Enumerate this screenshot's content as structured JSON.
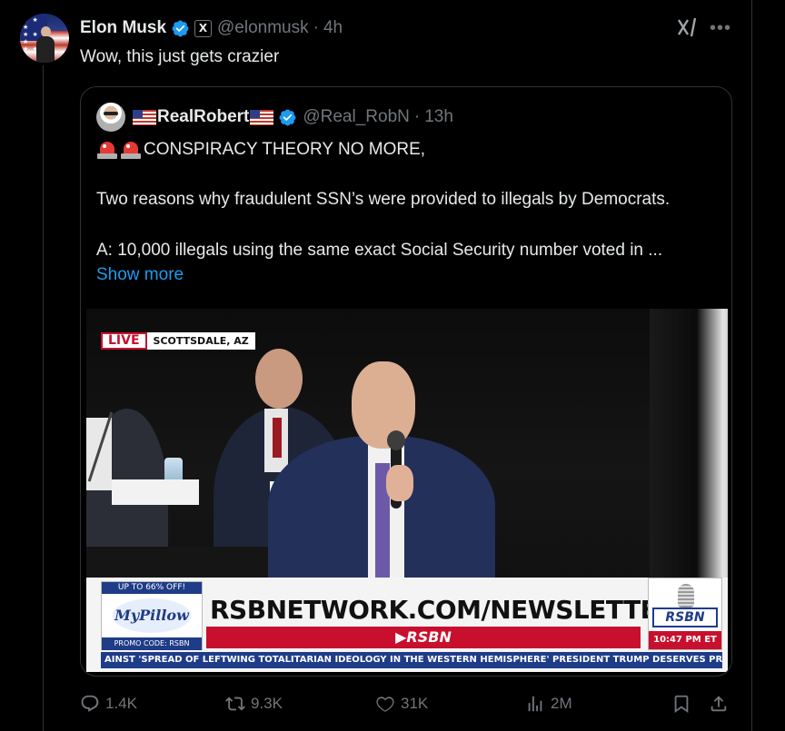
{
  "tweet": {
    "author_name": "Elon Musk",
    "x_badge": "X",
    "handle": "@elonmusk",
    "separator": "·",
    "time": "4h",
    "text": "Wow, this just gets crazier"
  },
  "quote": {
    "author_name": "RealRobert",
    "handle": "@Real_RobN",
    "separator": "·",
    "time": "13h",
    "line1": "CONSPIRACY THEORY NO MORE,",
    "line2": "Two reasons why fraudulent SSN’s were provided to illegals by Democrats.",
    "line3": "A: 10,000 illegals using the same exact Social Security number voted in ...",
    "show_more": "Show more"
  },
  "video": {
    "live": "LIVE",
    "location": "SCOTTSDALE, AZ",
    "pillow_top": "UP TO 66% OFF!",
    "pillow_logo": "MyPillow",
    "pillow_promo": "PROMO CODE: RSBN",
    "headline": "RSBNETWORK.COM/NEWSLETTER",
    "rsbn_bar": "▶RSBN",
    "rsbn_logo": "RSBN",
    "clock": "10:47 PM ET",
    "ticker": "AINST 'SPREAD OF LEFTWING TOTALITARIAN IDEOLOGY IN THE WESTERN HEMISPHERE'    PRESIDENT TRUMP DESERVES PRAISE"
  },
  "actions": {
    "replies": "1.4K",
    "reposts": "9.3K",
    "likes": "31K",
    "views": "2M"
  },
  "colors": {
    "background": "#000000",
    "text": "#e7e9ea",
    "muted": "#71767b",
    "link": "#1d9bf0",
    "verified": "#1d9bf0",
    "border": "#2f3336"
  }
}
